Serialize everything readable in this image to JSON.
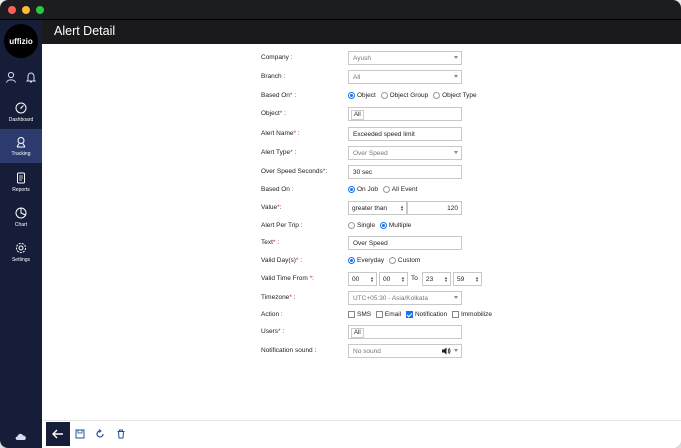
{
  "app": {
    "logo_text": "uffizio",
    "page_title": "Alert Detail"
  },
  "sidebar": {
    "items": [
      {
        "label": "Dashboard",
        "icon": "dashboard-icon"
      },
      {
        "label": "Tracking",
        "icon": "tracking-icon"
      },
      {
        "label": "Reports",
        "icon": "reports-icon"
      },
      {
        "label": "Chart",
        "icon": "chart-icon"
      },
      {
        "label": "Settings",
        "icon": "settings-icon"
      }
    ],
    "active": "Tracking"
  },
  "form": {
    "company": {
      "label": "Company :",
      "value": "Ayush"
    },
    "branch": {
      "label": "Branch :",
      "value": "All"
    },
    "based_on": {
      "label": "Based On",
      "suffix": " :",
      "options": [
        "Object",
        "Object Group",
        "Object Type"
      ],
      "selected": "Object"
    },
    "object": {
      "label": "Object",
      "suffix": " :",
      "chip": "All"
    },
    "alert_name": {
      "label": "Alert Name",
      "suffix": " :",
      "value": "Exceeded speed limit"
    },
    "alert_type": {
      "label": "Alert Type",
      "suffix": " :",
      "value": "Over Speed"
    },
    "over_speed_seconds": {
      "label": "Over Speed Seconds",
      "suffix": ":",
      "value": "30 sec"
    },
    "based_on2": {
      "label": "Based On :",
      "options": [
        "On Job",
        "All Event"
      ],
      "selected": "On Job"
    },
    "value": {
      "label": "Value",
      "suffix": ":",
      "operator": "greater than",
      "number": "120"
    },
    "alert_per_trip": {
      "label": "Alert Per Trip :",
      "options": [
        "Single",
        "Multiple"
      ],
      "selected": "Multiple"
    },
    "text": {
      "label": "Text",
      "suffix": " :",
      "value": "Over Speed"
    },
    "valid_days": {
      "label": "Valid Day(s)",
      "suffix": " :",
      "options": [
        "Everyday",
        "Custom"
      ],
      "selected": "Everyday"
    },
    "valid_time": {
      "label": "Valid Time From ",
      "suffix": ":",
      "from_h": "00",
      "from_m": "00",
      "to_label": "To",
      "to_h": "23",
      "to_m": "59"
    },
    "timezone": {
      "label": "Timezone",
      "suffix": " :",
      "value": "UTC+05:30 - Asia/Kolkata"
    },
    "action": {
      "label": "Action :",
      "options": [
        "SMS",
        "Email",
        "Notification",
        "Immobilize"
      ],
      "checked": [
        "Notification"
      ]
    },
    "users": {
      "label": "Users",
      "suffix": " :",
      "chip": "All"
    },
    "notification_sound": {
      "label": "Notification sound :",
      "value": "No sound"
    }
  },
  "colors": {
    "sidebar": "#151d38",
    "header": "#1a1a1c",
    "accent": "#1a73e8",
    "required": "#d02020"
  },
  "footer": {
    "buttons": [
      "back-icon",
      "save-icon",
      "reset-icon",
      "delete-icon"
    ]
  }
}
